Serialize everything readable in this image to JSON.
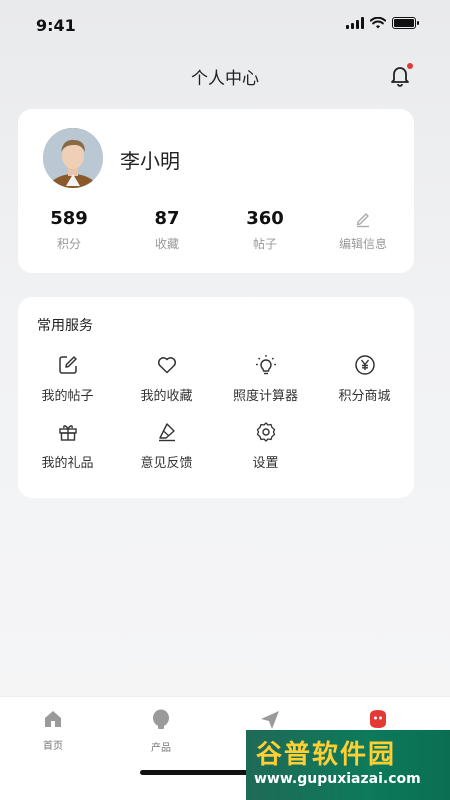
{
  "status": {
    "time": "9:41"
  },
  "header": {
    "title": "个人中心"
  },
  "profile": {
    "name": "李小明",
    "stats": [
      {
        "value": "589",
        "label": "积分"
      },
      {
        "value": "87",
        "label": "收藏"
      },
      {
        "value": "360",
        "label": "帖子"
      }
    ],
    "edit_label": "编辑信息"
  },
  "services": {
    "title": "常用服务",
    "items": [
      {
        "label": "我的帖子",
        "icon": "edit-square-icon"
      },
      {
        "label": "我的收藏",
        "icon": "heart-icon"
      },
      {
        "label": "照度计算器",
        "icon": "lightbulb-icon"
      },
      {
        "label": "积分商城",
        "icon": "yen-coin-icon"
      },
      {
        "label": "我的礼品",
        "icon": "gift-icon"
      },
      {
        "label": "意见反馈",
        "icon": "feedback-icon"
      },
      {
        "label": "设置",
        "icon": "gear-icon"
      }
    ]
  },
  "tabbar": {
    "items": [
      {
        "label": "首页",
        "icon": "home-icon"
      },
      {
        "label": "产品",
        "icon": "bulb-icon"
      },
      {
        "label": "",
        "icon": "send-icon"
      },
      {
        "label": "",
        "icon": "profile-icon"
      }
    ]
  },
  "watermark": {
    "top": "谷普软件园",
    "bottom": "www.gupuxiazai.com"
  },
  "colors": {
    "accent": "#e53935",
    "card_bg": "#ffffff",
    "muted_text": "#999999"
  }
}
